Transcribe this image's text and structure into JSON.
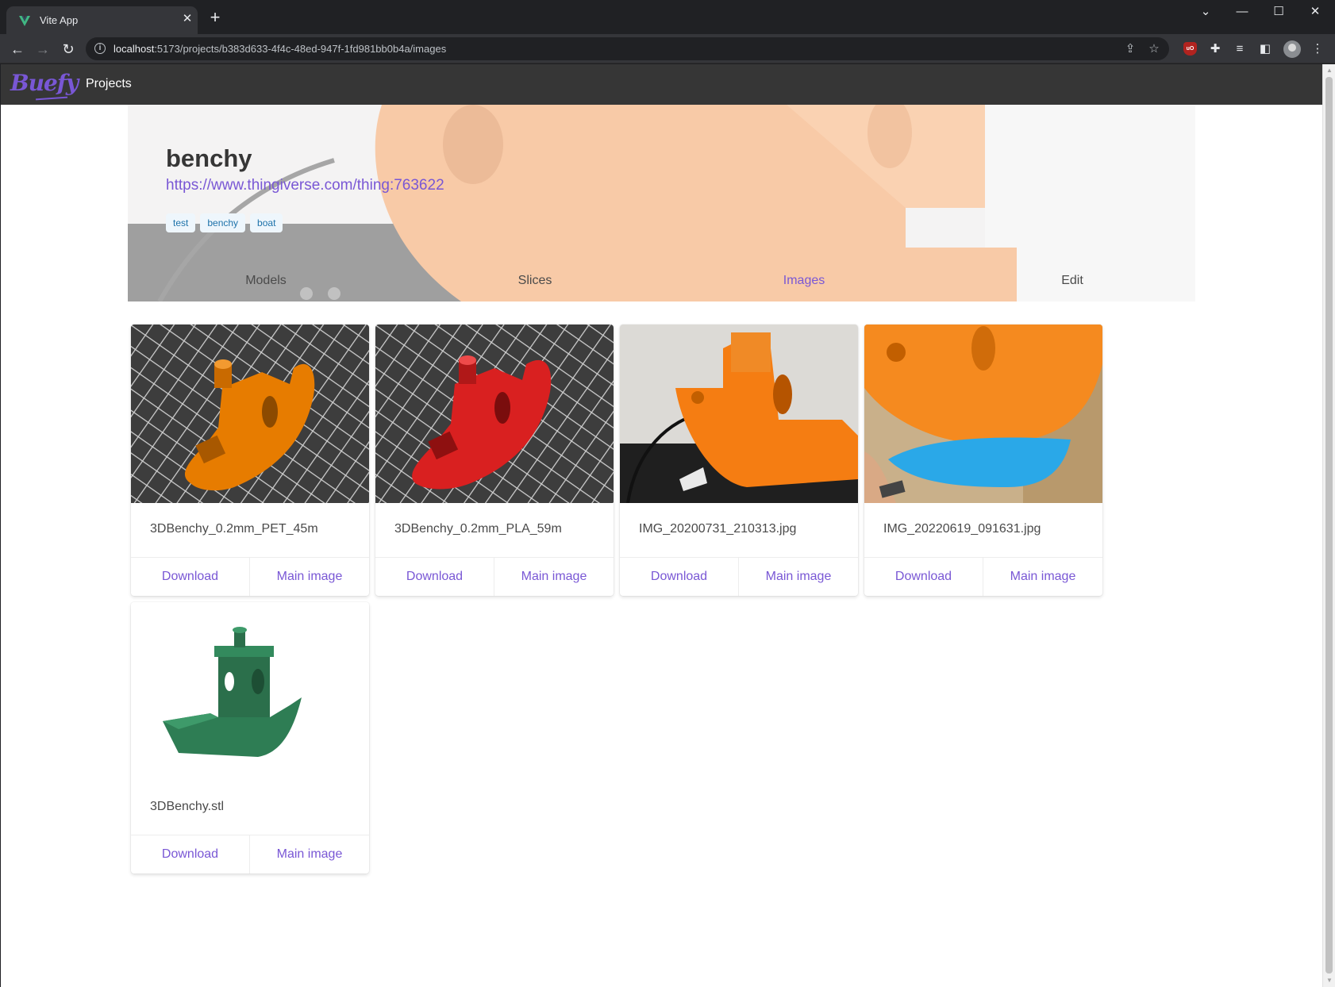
{
  "browser": {
    "tab_title": "Vite App",
    "url_host": "localhost",
    "url_rest": ":5173/projects/b383d633-4f4c-48ed-947f-1fd981bb0b4a/images"
  },
  "navbar": {
    "brand": "Buefy",
    "projects_label": "Projects"
  },
  "project": {
    "title": "benchy",
    "link": "https://www.thingiverse.com/thing:763622",
    "tags": [
      "test",
      "benchy",
      "boat"
    ]
  },
  "tabs": {
    "models": "Models",
    "slices": "Slices",
    "images": "Images",
    "edit": "Edit"
  },
  "images": [
    {
      "name": "3DBenchy_0.2mm_PET_45m",
      "download": "Download",
      "main": "Main image",
      "color": "#e77c00"
    },
    {
      "name": "3DBenchy_0.2mm_PLA_59m",
      "download": "Download",
      "main": "Main image",
      "color": "#d92020"
    },
    {
      "name": "IMG_20200731_210313.jpg",
      "download": "Download",
      "main": "Main image",
      "color": "#f57d12"
    },
    {
      "name": "IMG_20220619_091631.jpg",
      "download": "Download",
      "main": "Main image",
      "color": "#f58a1f"
    },
    {
      "name": "3DBenchy.stl",
      "download": "Download",
      "main": "Main image",
      "color": "#2e7d54"
    }
  ],
  "colors": {
    "primary": "#7957d5",
    "navbar": "#363636",
    "tag_bg": "#eef6fc",
    "tag_text": "#1d72aa"
  }
}
